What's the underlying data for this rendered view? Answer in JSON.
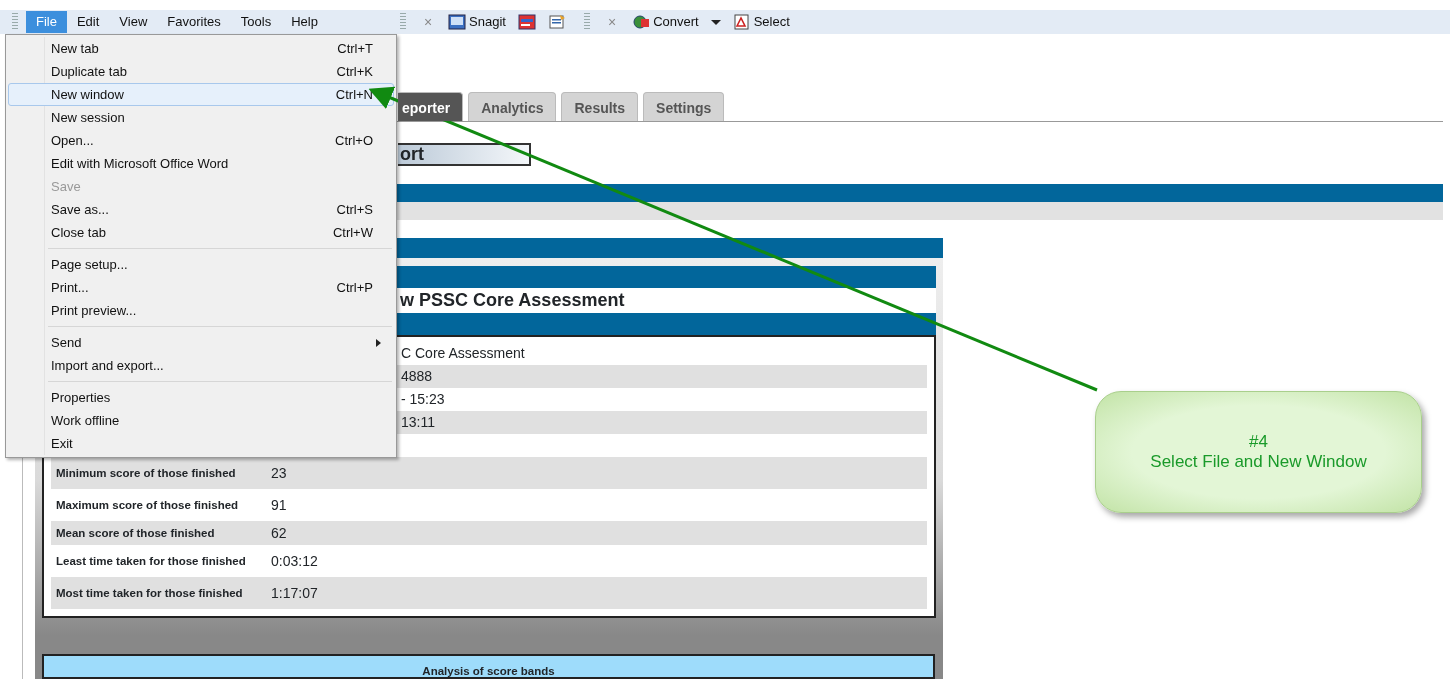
{
  "menubar": [
    {
      "label": "File",
      "selected": true
    },
    {
      "label": "Edit",
      "selected": false
    },
    {
      "label": "View",
      "selected": false
    },
    {
      "label": "Favorites",
      "selected": false
    },
    {
      "label": "Tools",
      "selected": false
    },
    {
      "label": "Help",
      "selected": false
    }
  ],
  "toolbar": [
    {
      "kind": "close",
      "label": "×"
    },
    {
      "kind": "button",
      "label": "Snagit"
    },
    {
      "kind": "icon"
    },
    {
      "kind": "icon"
    },
    {
      "kind": "grip"
    },
    {
      "kind": "close",
      "label": "×"
    },
    {
      "kind": "button",
      "label": "Convert"
    },
    {
      "kind": "caret"
    },
    {
      "kind": "button",
      "label": "Select"
    }
  ],
  "file_menu": [
    {
      "kind": "item",
      "label": "New tab",
      "shortcut": "Ctrl+T",
      "disabled": false,
      "selected": false
    },
    {
      "kind": "item",
      "label": "Duplicate tab",
      "shortcut": "Ctrl+K",
      "disabled": false,
      "selected": false
    },
    {
      "kind": "item",
      "label": "New window",
      "shortcut": "Ctrl+N",
      "disabled": false,
      "selected": true
    },
    {
      "kind": "item",
      "label": "New session",
      "disabled": false,
      "selected": false
    },
    {
      "kind": "item",
      "label": "Open...",
      "shortcut": "Ctrl+O",
      "disabled": false,
      "selected": false
    },
    {
      "kind": "item",
      "label": "Edit with Microsoft Office Word",
      "disabled": false,
      "selected": false
    },
    {
      "kind": "item",
      "label": "Save",
      "disabled": true,
      "selected": false
    },
    {
      "kind": "item",
      "label": "Save as...",
      "shortcut": "Ctrl+S",
      "disabled": false,
      "selected": false
    },
    {
      "kind": "item",
      "label": "Close tab",
      "shortcut": "Ctrl+W",
      "disabled": false,
      "selected": false
    },
    {
      "kind": "separator"
    },
    {
      "kind": "item",
      "label": "Page setup...",
      "disabled": false,
      "selected": false
    },
    {
      "kind": "item",
      "label": "Print...",
      "shortcut": "Ctrl+P",
      "disabled": false,
      "selected": false
    },
    {
      "kind": "item",
      "label": "Print preview...",
      "disabled": false,
      "selected": false
    },
    {
      "kind": "separator"
    },
    {
      "kind": "submenu",
      "label": "Send",
      "disabled": false,
      "selected": false
    },
    {
      "kind": "item",
      "label": "Import and export...",
      "disabled": false,
      "selected": false
    },
    {
      "kind": "separator"
    },
    {
      "kind": "item",
      "label": "Properties",
      "disabled": false,
      "selected": false
    },
    {
      "kind": "item",
      "label": "Work offline",
      "disabled": false,
      "selected": false
    },
    {
      "kind": "item",
      "label": "Exit",
      "disabled": false,
      "selected": false
    }
  ],
  "tabs": [
    {
      "label": "eporter",
      "selected": true
    },
    {
      "label": "Analytics",
      "selected": false
    },
    {
      "label": "Results",
      "selected": false
    },
    {
      "label": "Settings",
      "selected": false
    }
  ],
  "report_title": "ort",
  "assessment_heading": "w PSSC Core Assessment",
  "summary_rows": [
    {
      "kind": "covered",
      "value": "C Core Assessment"
    },
    {
      "kind": "covered",
      "value": "4888"
    },
    {
      "kind": "covered",
      "value": "- 15:23"
    },
    {
      "kind": "covered",
      "value": "13:11"
    },
    {
      "kind": "covered"
    },
    {
      "kind": "full",
      "label": "Minimum score of those finished",
      "value": "23"
    },
    {
      "kind": "full",
      "label": "Maximum score of those finished",
      "value": "91"
    },
    {
      "kind": "full",
      "label": "Mean score of those finished",
      "value": "62"
    },
    {
      "kind": "full",
      "label": "Least time taken for those finished",
      "value": "0:03:12"
    },
    {
      "kind": "full",
      "label": "Most time taken for those finished",
      "value": "1:17:07"
    }
  ],
  "score_bands": {
    "title": "Analysis of score bands"
  },
  "callout": {
    "step": "#4",
    "text": "Select File and New Window"
  }
}
